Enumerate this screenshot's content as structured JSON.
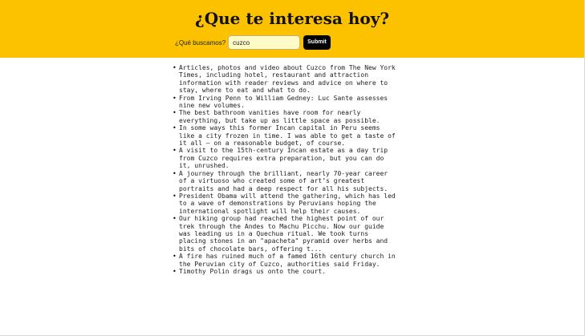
{
  "header": {
    "title": "¿Que te interesa hoy?",
    "search_label": "¿Qué buscamos?",
    "search_value": "cuzco",
    "submit_label": "Submit"
  },
  "results": [
    "Articles, photos and video about Cuzco from The New York Times, including hotel, restaurant and attraction information with reader reviews and advice on where to stay, where to eat and what to do.",
    "From Irving Penn to William Gedney: Luc Sante assesses nine new volumes.",
    "The best bathroom vanities have room for nearly everything, but take up as little space as possible.",
    "In some ways this former Incan capital in Peru seems like a city frozen in time. I was able to get a taste of it all — on a reasonable budget, of course.",
    "A visit to the 15th-century Incan estate as a day trip from Cuzco requires extra preparation, but you can do it, unrushed.",
    "A journey through the brilliant, nearly 70-year career of a virtuoso who created some of art’s greatest portraits and had a deep respect for all his subjects.",
    "President Obama will attend the gathering, which has led to a wave of demonstrations by Peruvians hoping the international spotlight will help their causes.",
    "Our hiking group had reached the highest point of our trek through the Andes to Machu Picchu. Now our guide was leading us in a Quechua ritual. We took turns placing stones in an \"apacheta\" pyramid over herbs and bits of chocolate bars, offering t...",
    "A fire has ruined much of a famed 16th century church in the Peruvian city of Cuzco, authorities said Friday.",
    "Timothy Polin drags us onto the court."
  ]
}
